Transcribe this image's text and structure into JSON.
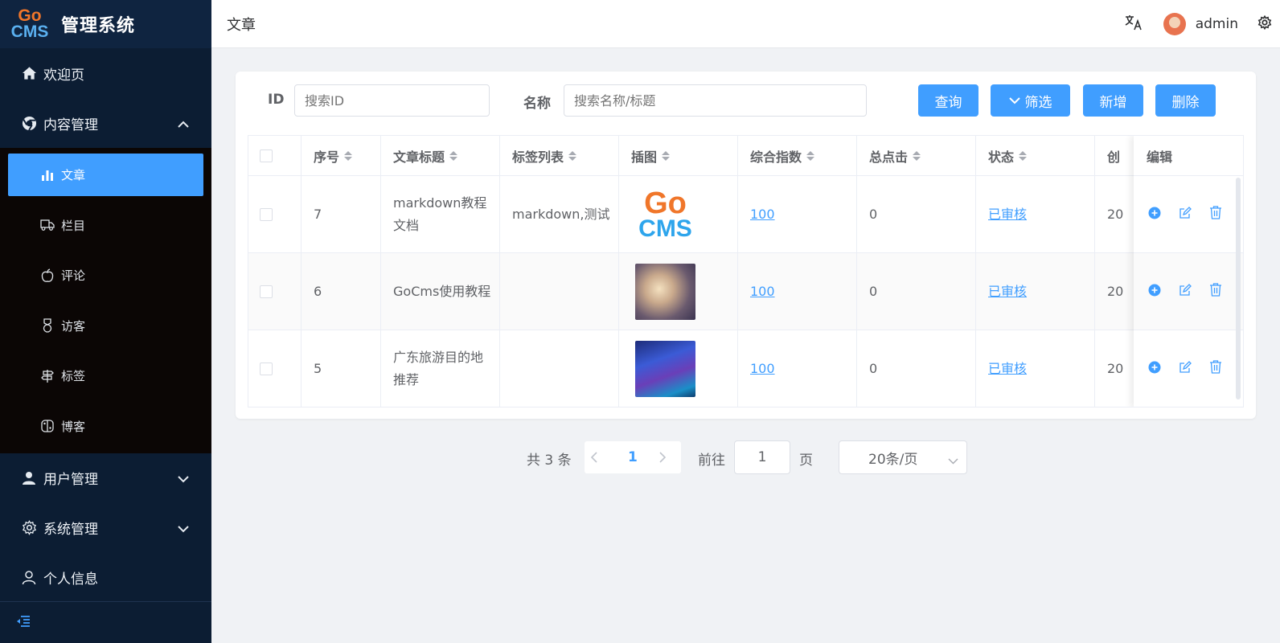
{
  "sidebar": {
    "logo_go": "Go",
    "logo_cms": "CMS",
    "title": "管理系统",
    "items": [
      {
        "label": "欢迎页",
        "icon": "home-icon"
      },
      {
        "label": "内容管理",
        "icon": "chrome-icon",
        "expanded": true
      },
      {
        "label": "用户管理",
        "icon": "user-icon"
      },
      {
        "label": "系统管理",
        "icon": "gear-icon"
      },
      {
        "label": "个人信息",
        "icon": "person-icon"
      }
    ],
    "sub_items": [
      {
        "label": "文章",
        "icon": "chart-bar-icon",
        "active": true
      },
      {
        "label": "栏目",
        "icon": "truck-icon"
      },
      {
        "label": "评论",
        "icon": "apple-icon"
      },
      {
        "label": "访客",
        "icon": "medal-icon"
      },
      {
        "label": "标签",
        "icon": "signpost-icon"
      },
      {
        "label": "博客",
        "icon": "switch-icon"
      }
    ]
  },
  "header": {
    "breadcrumb": "文章",
    "username": "admin"
  },
  "search": {
    "id_label": "ID",
    "id_placeholder": "搜索ID",
    "name_label": "名称",
    "name_placeholder": "搜索名称/标题",
    "query_btn": "查询",
    "filter_btn": "筛选",
    "add_btn": "新增",
    "delete_btn": "删除"
  },
  "table": {
    "columns": [
      "序号",
      "文章标题",
      "标签列表",
      "插图",
      "综合指数",
      "总点击",
      "状态",
      "创",
      "编辑"
    ],
    "rows": [
      {
        "id": "7",
        "title": "markdown教程文档",
        "tags": "markdown,测试",
        "score": "100",
        "clicks": "0",
        "status": "已审核",
        "created": "20"
      },
      {
        "id": "6",
        "title": "GoCms使用教程",
        "tags": "",
        "score": "100",
        "clicks": "0",
        "status": "已审核",
        "created": "20"
      },
      {
        "id": "5",
        "title": "广东旅游目的地推荐",
        "tags": "",
        "score": "100",
        "clicks": "0",
        "status": "已审核",
        "created": "20"
      }
    ],
    "thumb_logo_go": "Go",
    "thumb_logo_cms": "CMS"
  },
  "pagination": {
    "total": "共 3 条",
    "current": "1",
    "goto": "前往",
    "goto_value": "1",
    "unit": "页",
    "page_size": "20条/页"
  },
  "colors": {
    "primary": "#409eff",
    "sidebar_bg": "#0c1d33",
    "submenu_bg": "#0b0605"
  }
}
